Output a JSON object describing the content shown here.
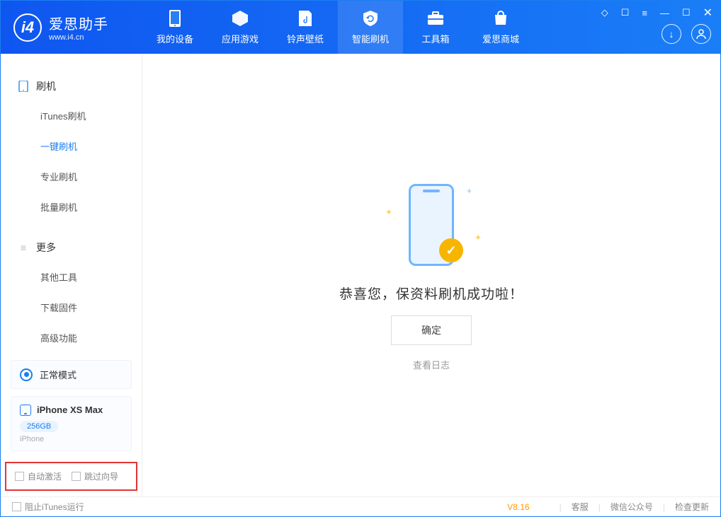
{
  "app": {
    "name": "爱思助手",
    "domain": "www.i4.cn"
  },
  "nav": {
    "items": [
      {
        "label": "我的设备"
      },
      {
        "label": "应用游戏"
      },
      {
        "label": "铃声壁纸"
      },
      {
        "label": "智能刷机"
      },
      {
        "label": "工具箱"
      },
      {
        "label": "爱思商城"
      }
    ]
  },
  "sidebar": {
    "group1": {
      "title": "刷机",
      "items": [
        "iTunes刷机",
        "一键刷机",
        "专业刷机",
        "批量刷机"
      ]
    },
    "group2": {
      "title": "更多",
      "items": [
        "其他工具",
        "下载固件",
        "高级功能"
      ]
    }
  },
  "device": {
    "mode": "正常模式",
    "name": "iPhone XS Max",
    "capacity": "256GB",
    "type": "iPhone"
  },
  "bottom_checks": {
    "auto_activate": "自动激活",
    "skip_wizard": "跳过向导"
  },
  "main": {
    "success": "恭喜您，保资料刷机成功啦！",
    "ok": "确定",
    "view_log": "查看日志"
  },
  "status": {
    "block_itunes": "阻止iTunes运行",
    "version": "V8.16",
    "cs": "客服",
    "wx": "微信公众号",
    "update": "检查更新"
  }
}
